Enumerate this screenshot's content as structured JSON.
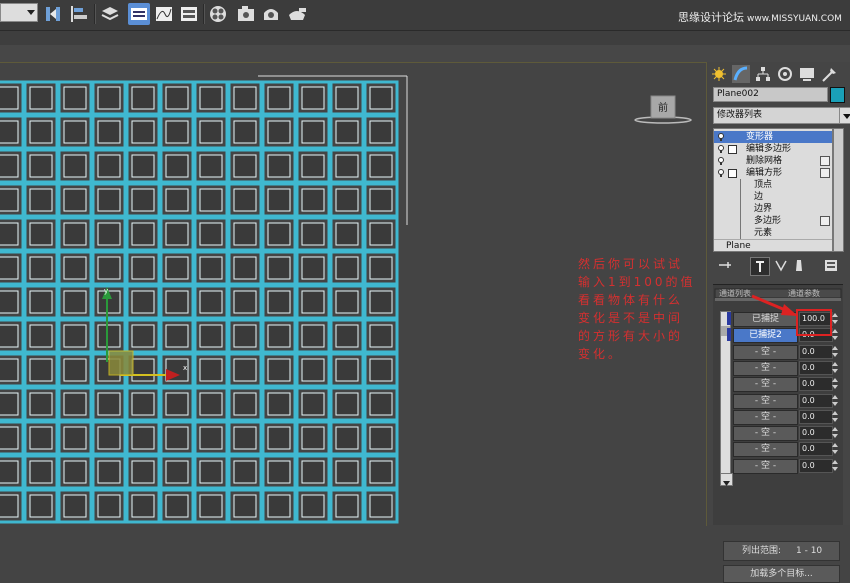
{
  "toolbar": {
    "icons": [
      "view-dropdown",
      "mirror-icon",
      "align-icon",
      "layer-icon",
      "graph-editor-icon",
      "curve-editor-icon",
      "schematic-icon",
      "material-editor-icon",
      "render-setup-icon",
      "render-frame-icon",
      "render-icon"
    ],
    "red_caption": "",
    "watermark": "思缘设计论坛",
    "watermark_url": "www.MISSYUAN.COM"
  },
  "viewport": {
    "view_cube_label": "前",
    "grid_color": "#3fb8d0",
    "background": "#444444",
    "annotation": [
      "然后你可以试试",
      "输入1到100的值",
      "看看物体有什么",
      "变化是不是中间",
      "的方形有大小的",
      "变化。"
    ]
  },
  "command_panel": {
    "object_name": "Plane002",
    "object_color": "#1aa0b8",
    "modifier_list_label": "修改器列表",
    "stack": [
      {
        "label": "变形器",
        "bulb": true,
        "expand": false,
        "selected": true,
        "check": false
      },
      {
        "label": "编辑多边形",
        "bulb": true,
        "expand": true,
        "selected": false,
        "check": false
      },
      {
        "label": "删除网格",
        "bulb": true,
        "expand": false,
        "selected": false,
        "check": true
      },
      {
        "label": "编辑方形",
        "bulb": true,
        "expand": true,
        "selected": false,
        "check": true
      }
    ],
    "sub_items": [
      "顶点",
      "边",
      "边界",
      "多边形",
      "元素"
    ],
    "stack_base": "Plane",
    "rollout_title": "通道列表",
    "rollout_title_right": "通道参数",
    "channels": [
      {
        "label": "已捕捉",
        "value": "100.0",
        "highlight": false
      },
      {
        "label": "已捕捉2",
        "value": "0.0",
        "highlight": true
      },
      {
        "label": "- 空 -",
        "value": "0.0",
        "highlight": false
      },
      {
        "label": "- 空 -",
        "value": "0.0",
        "highlight": false
      },
      {
        "label": "- 空 -",
        "value": "0.0",
        "highlight": false
      },
      {
        "label": "- 空 -",
        "value": "0.0",
        "highlight": false
      },
      {
        "label": "- 空 -",
        "value": "0.0",
        "highlight": false
      },
      {
        "label": "- 空 -",
        "value": "0.0",
        "highlight": false
      },
      {
        "label": "- 空 -",
        "value": "0.0",
        "highlight": false
      },
      {
        "label": "- 空 -",
        "value": "0.0",
        "highlight": false
      }
    ],
    "range_label": "列出范围:",
    "range_value": "1 - 10",
    "load_button": "加载多个目标..."
  }
}
